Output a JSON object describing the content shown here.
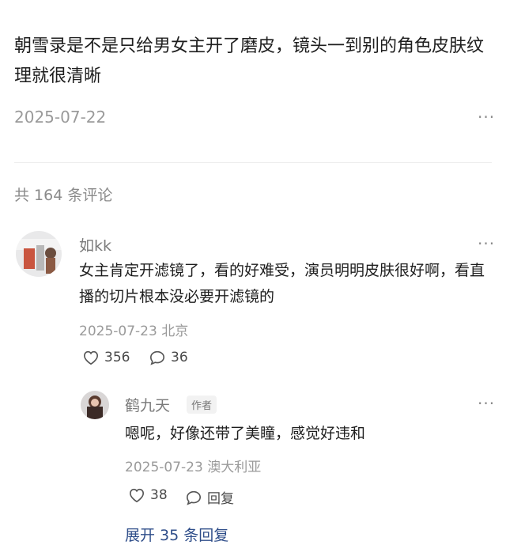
{
  "post": {
    "text": "朝雪录是不是只给男女主开了磨皮，镜头一到别的角色皮肤纹理就很清晰",
    "date": "2025-07-22",
    "more_glyph": "···"
  },
  "comments_count_label": "共 164 条评论",
  "comments": [
    {
      "name": "如kk",
      "text": "女主肯定开滤镜了，看的好难受，演员明明皮肤很好啊，看直播的切片根本没必要开滤镜的",
      "meta": "2025-07-23 北京",
      "likes": "356",
      "replies": "36",
      "more_glyph": "···"
    }
  ],
  "reply": {
    "name": "鹤九天",
    "badge": "作者",
    "text": "嗯呢，好像还带了美瞳，感觉好违和",
    "meta": "2025-07-23 澳大利亚",
    "likes": "38",
    "reply_label": "回复",
    "more_glyph": "···"
  },
  "expand_label": "展开 35 条回复",
  "icons": [
    "more-icon",
    "heart-icon",
    "comment-icon"
  ]
}
